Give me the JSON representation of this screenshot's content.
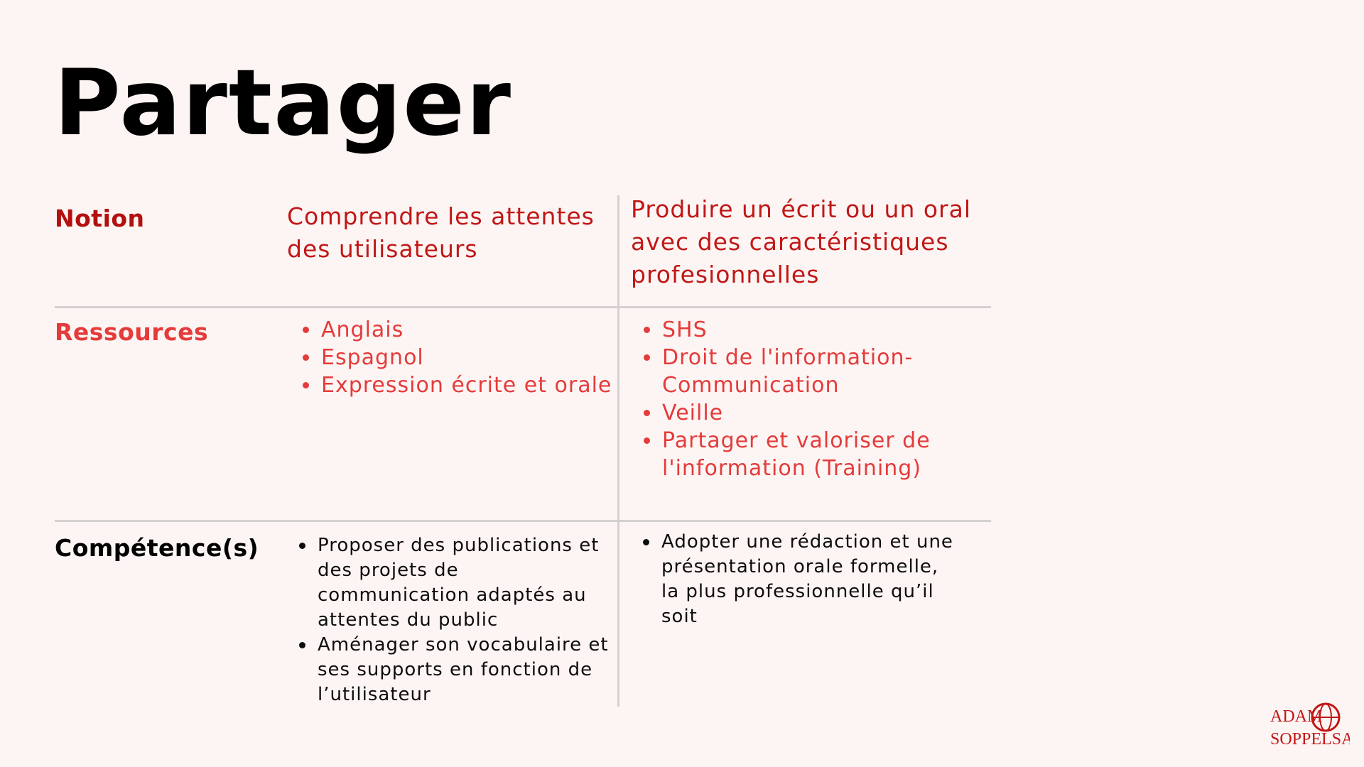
{
  "slide": {
    "title": "Partager"
  },
  "rows": {
    "notion_label": "Notion",
    "resources_label": "Ressources",
    "skills_label": "Compétence(s)"
  },
  "columns": [
    {
      "notion": "Comprendre les attentes des utilisateurs",
      "resources": [
        "Anglais",
        "Espagnol",
        "Expression écrite et orale"
      ],
      "skills": [
        "Proposer des publications et des projets de communication adaptés au attentes du public",
        "Aménager son vocabulaire et ses supports en fonction de l’utilisateur"
      ]
    },
    {
      "notion": "Produire un écrit ou un oral avec des caractéristiques profesionnelles",
      "resources": [
        "SHS",
        "Droit de l'information-Communication",
        "Veille",
        "Partager et valoriser de l'information (Training)"
      ],
      "skills": [
        "Adopter une rédaction et une présentation orale formelle, la plus professionnelle qu’il soit"
      ]
    }
  ],
  "logo": {
    "line1": "ADAM",
    "line2": "SOPPELSA.",
    "color": "#c01717",
    "icon": "globe-icon"
  },
  "colors": {
    "background": "#fdf5f3",
    "dark_red": "#c01717",
    "red": "#e43b3b",
    "divider": "#d4d1d0"
  }
}
